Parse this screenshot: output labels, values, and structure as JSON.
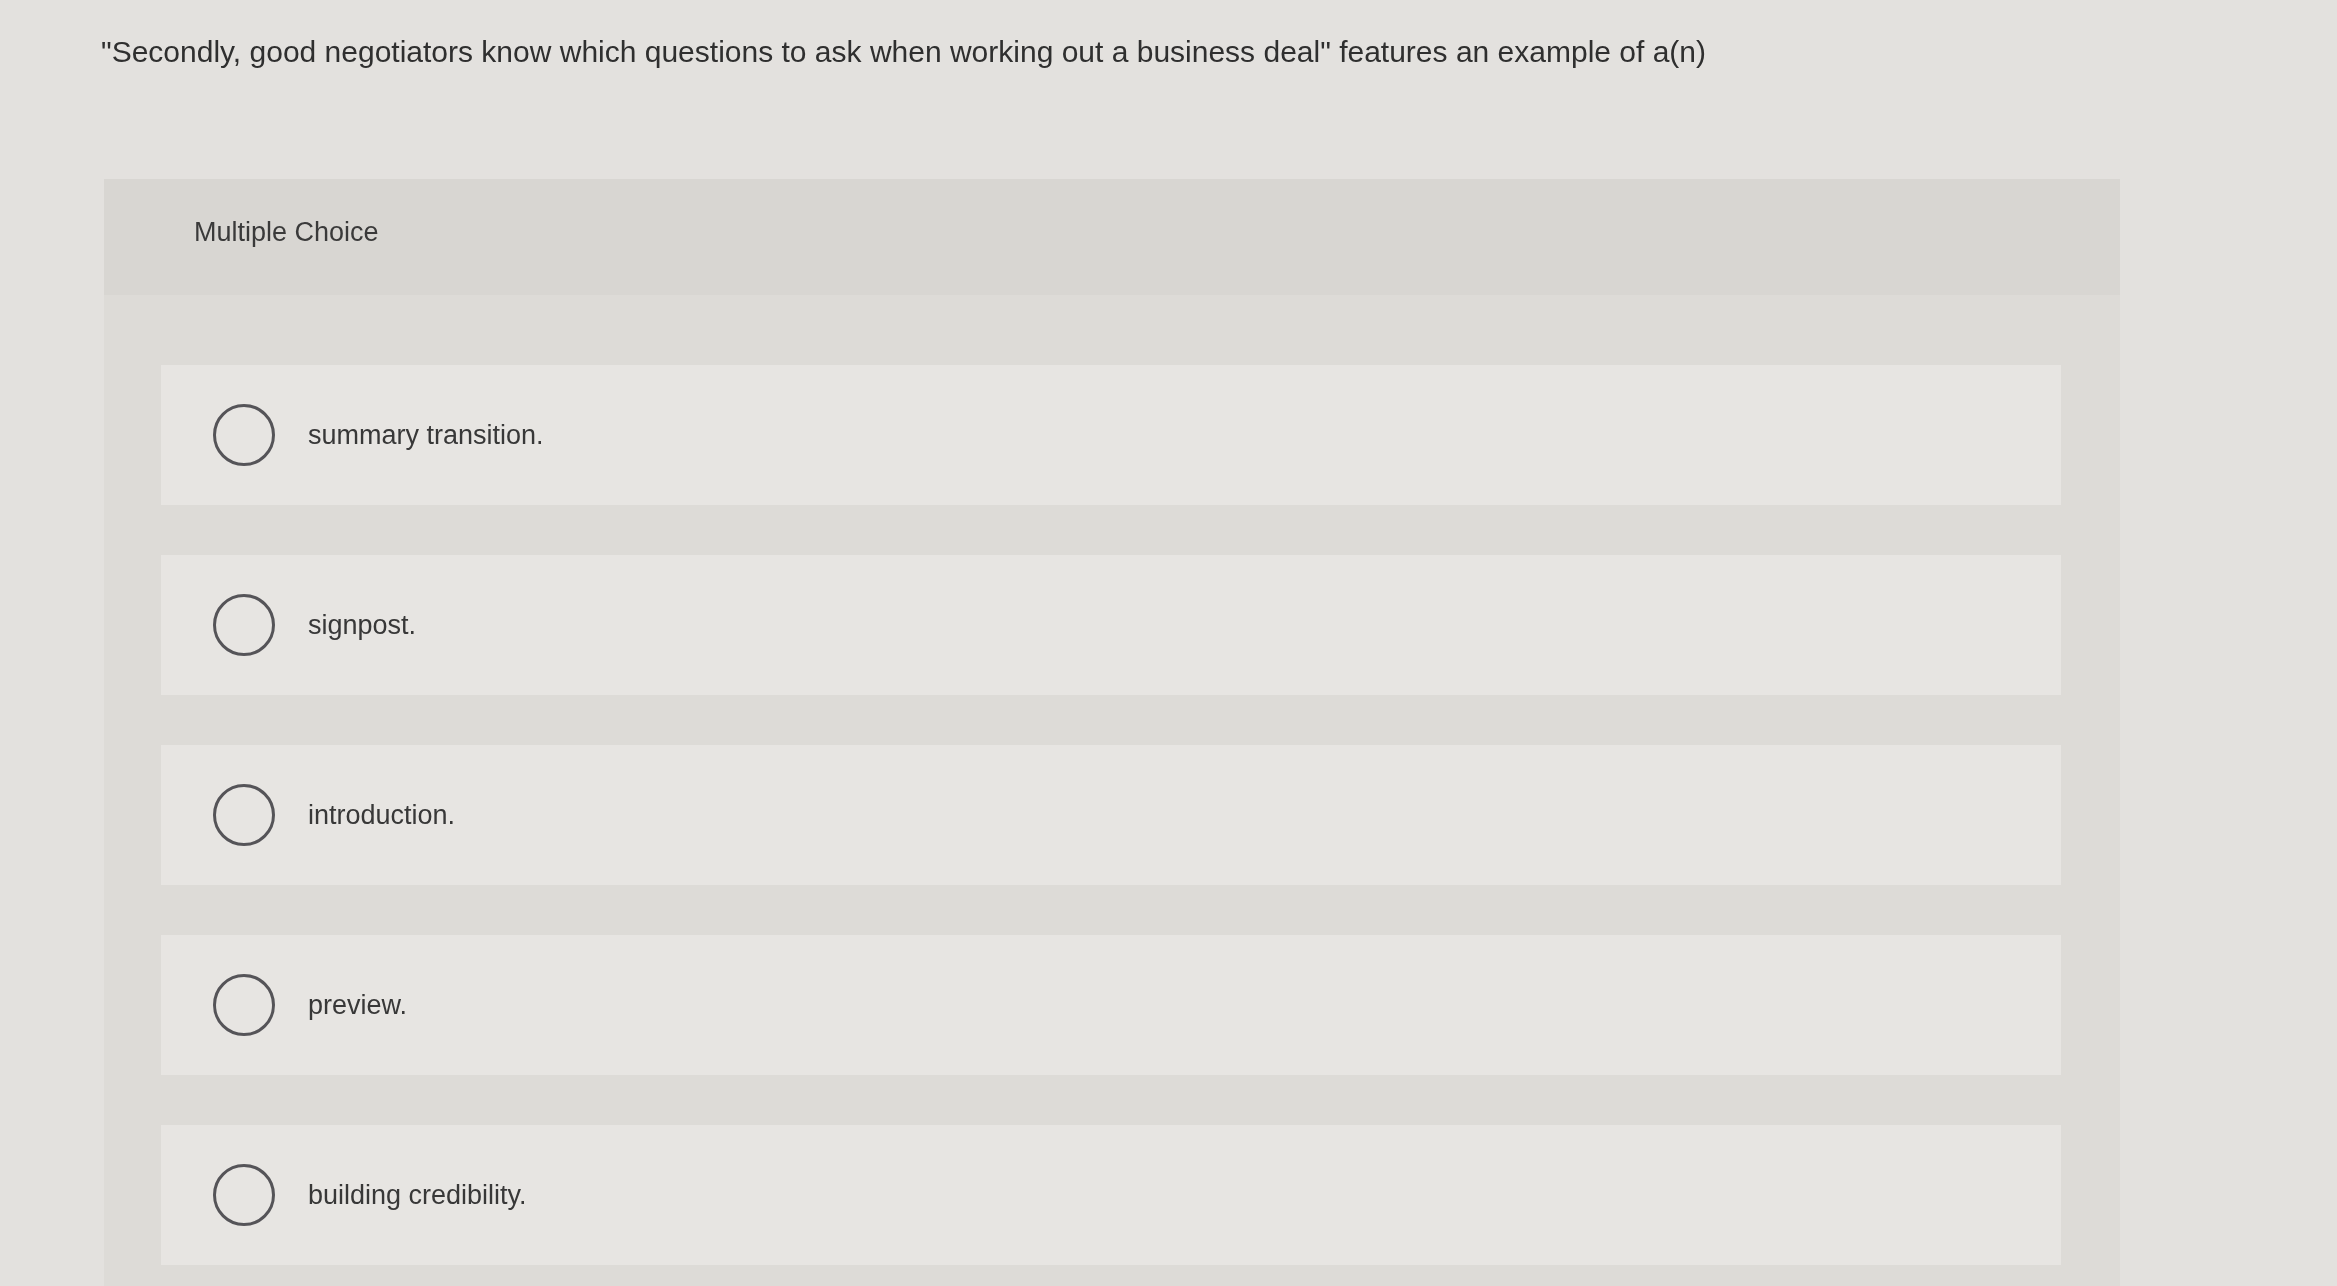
{
  "question": {
    "text": "\"Secondly, good negotiators know which questions to ask when working out a business deal\" features an example of a(n)"
  },
  "section_label": "Multiple Choice",
  "options": [
    {
      "label": "summary transition.",
      "selected": false
    },
    {
      "label": "signpost.",
      "selected": false
    },
    {
      "label": "introduction.",
      "selected": false
    },
    {
      "label": "preview.",
      "selected": false
    },
    {
      "label": "building credibility.",
      "selected": false
    }
  ]
}
